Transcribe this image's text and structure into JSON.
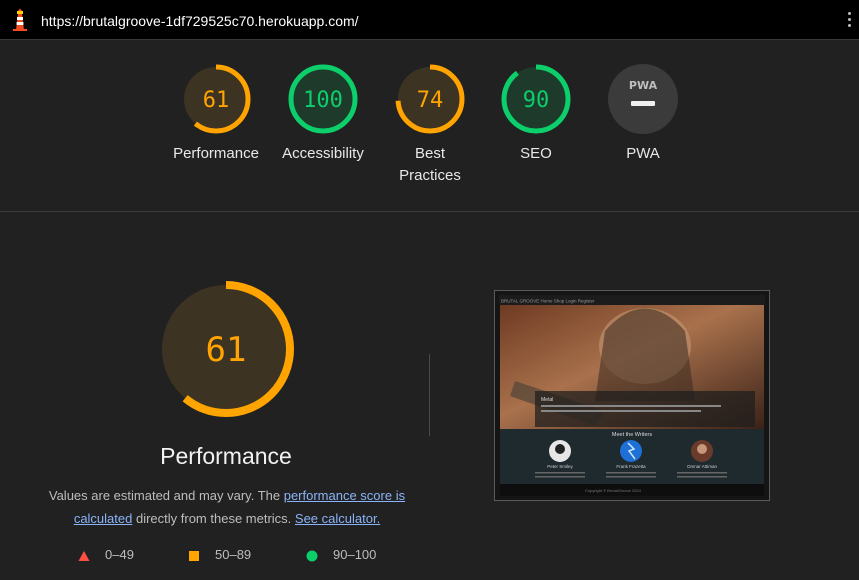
{
  "url_bar": {
    "url": "https://brutalgroove-1df729525c70.herokuapp.com/"
  },
  "colors": {
    "pass": "#0cce6b",
    "average": "#ffa400",
    "fail": "#ff4e42",
    "pwa_gray": "#3b3b3b"
  },
  "gauges": [
    {
      "score": "61",
      "label": "Performance",
      "value": 61,
      "status": "average"
    },
    {
      "score": "100",
      "label": "Accessibility",
      "value": 100,
      "status": "pass"
    },
    {
      "score": "74",
      "label": "Best Practices",
      "value": 74,
      "status": "average"
    },
    {
      "score": "90",
      "label": "SEO",
      "value": 90,
      "status": "pass"
    },
    {
      "score": "",
      "label": "PWA",
      "badge": "PWA",
      "status": "na"
    }
  ],
  "performance": {
    "score": "61",
    "value": 61,
    "title": "Performance",
    "desc_prefix": "Values are estimated and may vary. The ",
    "link_score": "performance score is calculated",
    "desc_middle": " directly from these metrics. ",
    "link_calc": "See calculator."
  },
  "legend": [
    {
      "shape": "triangle",
      "range": "0–49"
    },
    {
      "shape": "square",
      "range": "50–89"
    },
    {
      "shape": "circle",
      "range": "90–100"
    }
  ],
  "preview": {
    "nav": "BRUTAL GROOVE   Home   Shop   Login   Register",
    "hero_title": "Metal",
    "section_title": "Meet the Writers",
    "writers": [
      "Peter Smiley",
      "Frank Frazetta",
      "Omnar Attiman"
    ],
    "footer": "Copyright © BrutalGroove 2024"
  }
}
